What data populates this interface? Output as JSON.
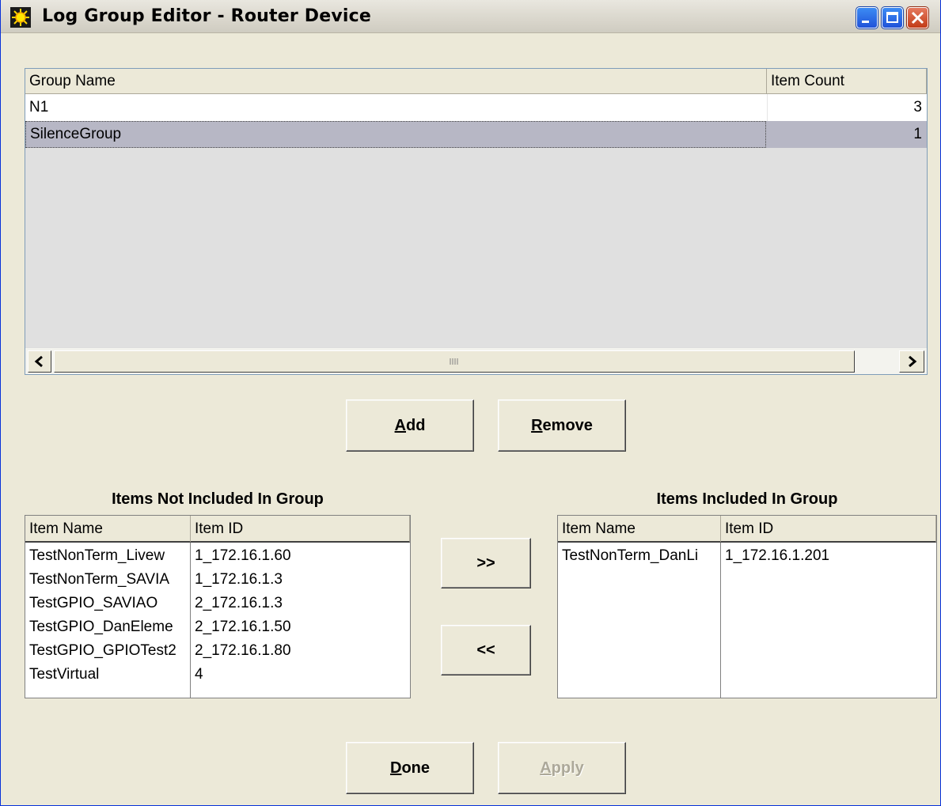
{
  "window": {
    "title": "Log Group Editor - Router Device",
    "icon": "sun-app-icon",
    "controls": [
      "minimize-icon",
      "maximize-icon",
      "close-icon"
    ]
  },
  "groups_table": {
    "columns": [
      "Group Name",
      "Item Count"
    ],
    "rows": [
      {
        "name": "N1",
        "count": "3",
        "selected": false
      },
      {
        "name": "SilenceGroup",
        "count": "1",
        "selected": true
      }
    ],
    "scrollbar": {
      "left_icon": "arrow-left-icon",
      "right_icon": "arrow-right-icon"
    }
  },
  "group_buttons": {
    "add_mnemonic": "A",
    "add_rest": "dd",
    "remove_mnemonic": "R",
    "remove_rest": "emove"
  },
  "not_included": {
    "title": "Items  Not Included In Group",
    "columns": [
      "Item Name",
      "Item ID"
    ],
    "rows": [
      {
        "name": "TestNonTerm_Livew",
        "id": "1_172.16.1.60"
      },
      {
        "name": "TestNonTerm_SAVIA",
        "id": "1_172.16.1.3"
      },
      {
        "name": "TestGPIO_SAVIAO",
        "id": "2_172.16.1.3"
      },
      {
        "name": "TestGPIO_DanEleme",
        "id": "2_172.16.1.50"
      },
      {
        "name": "TestGPIO_GPIOTest2",
        "id": "2_172.16.1.80"
      },
      {
        "name": "TestVirtual",
        "id": "4"
      }
    ]
  },
  "transfer": {
    "add_label": ">>",
    "remove_label": "<<"
  },
  "included": {
    "title": "Items Included In Group",
    "columns": [
      "Item Name",
      "Item ID"
    ],
    "rows": [
      {
        "name": "TestNonTerm_DanLi",
        "id": "1_172.16.1.201"
      }
    ]
  },
  "footer": {
    "done_mnemonic": "D",
    "done_rest": "one",
    "apply_mnemonic": "A",
    "apply_rest": "pply",
    "apply_disabled": true
  },
  "colors": {
    "selected_row": "#b7b7c5",
    "window_bg": "#ece9d8",
    "titlebar": "#dcd9cf"
  }
}
